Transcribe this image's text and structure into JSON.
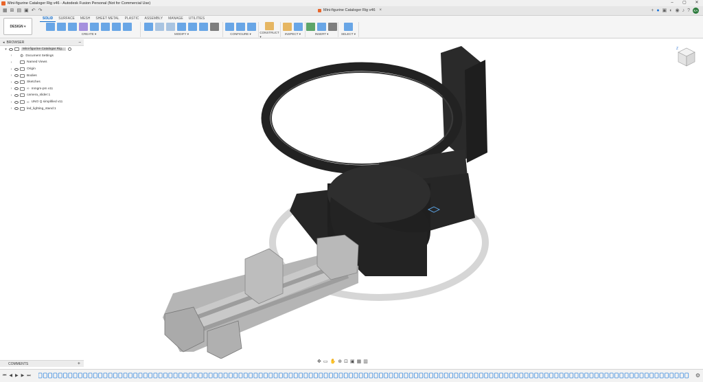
{
  "window": {
    "title": "Mini-figurine Cataloger Rig v46 - Autodesk Fusion Personal (Not for Commercial Use)",
    "controls": [
      "minimize-icon",
      "maximize-icon",
      "close-icon"
    ]
  },
  "document_tab": {
    "label": "Mini-figurine Cataloger Rig v46",
    "close": "×"
  },
  "user": {
    "initials": "KA"
  },
  "toolbar": {
    "workspace": "DESIGN",
    "tabs": [
      "SOLID",
      "SURFACE",
      "MESH",
      "SHEET METAL",
      "PLASTIC",
      "ASSEMBLY",
      "MANAGE",
      "UTILITIES"
    ],
    "active_tab": "SOLID",
    "groups": [
      {
        "label": "CREATE ▾",
        "icons": [
          "#3a8be0",
          "#3a8be0",
          "#3a8be0",
          "#8a6ed6",
          "#3a8be0",
          "#3a8be0",
          "#3a8be0",
          "#3a8be0"
        ]
      },
      {
        "label": "MODIFY ▾",
        "icons": [
          "#3a8be0",
          "#8fb3d9",
          "#8fb3d9",
          "#3a8be0",
          "#3a8be0",
          "#3a8be0",
          "#555555"
        ]
      },
      {
        "label": "CONFIGURE ▾",
        "icons": [
          "#3a8be0",
          "#3a8be0",
          "#3a8be0"
        ]
      },
      {
        "label": "CONSTRUCT ▾",
        "icons": [
          "#e0a030"
        ]
      },
      {
        "label": "INSPECT ▾",
        "icons": [
          "#e0a030",
          "#3a8be0"
        ]
      },
      {
        "label": "INSERT ▾",
        "icons": [
          "#2a8a3b",
          "#3a8be0",
          "#555555"
        ]
      },
      {
        "label": "SELECT ▾",
        "icons": [
          "#3a8be0"
        ]
      }
    ]
  },
  "browser": {
    "header": "BROWSER",
    "root": "Mini-figurine Catalogar Rig...",
    "items": [
      {
        "label": "Document Settings",
        "icon": "gear-icon"
      },
      {
        "label": "Named Views",
        "icon": "folder-icon"
      },
      {
        "label": "Origin",
        "icon": "folder-icon"
      },
      {
        "label": "Bodies",
        "icon": "folder-icon"
      },
      {
        "label": "Sketches",
        "icon": "folder-icon"
      },
      {
        "label": "mmgm-pm v11",
        "icon": "component-link-icon"
      },
      {
        "label": "camera_slider:1",
        "icon": "component-icon"
      },
      {
        "label": "UNO Q simplified v11",
        "icon": "component-link-icon"
      },
      {
        "label": "led_lighting_stand:1",
        "icon": "component-icon"
      }
    ]
  },
  "comments": {
    "label": "COMMENTS",
    "add": "+"
  },
  "colors": {
    "accent": "#0a68c9",
    "model_dark": "#2b2b2b",
    "model_light": "#b8b8b8",
    "ground_ring": "#cfcfcf"
  }
}
